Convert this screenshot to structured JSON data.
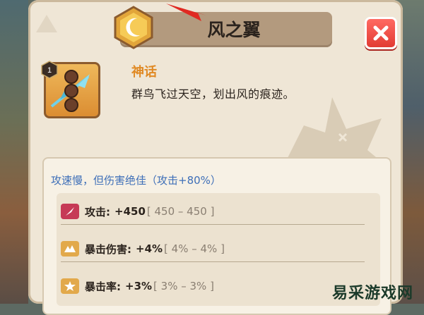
{
  "dialog": {
    "title": "风之翼",
    "close_icon": "close-x-icon"
  },
  "item": {
    "level_badge": "1",
    "rarity": "神话",
    "description": "群鸟飞过天空，划出风的痕迹。"
  },
  "stats": {
    "intro": "攻速慢，但伤害绝佳（攻击+80%）",
    "rows": [
      {
        "icon": "attack-icon",
        "name": "攻击:",
        "value": "+450",
        "range": "[ 450 – 450 ]",
        "icon_color": "#c63a56"
      },
      {
        "icon": "crit-damage-icon",
        "name": "暴击伤害:",
        "value": "+4%",
        "range": "[ 4% – 4% ]",
        "icon_color": "#e2a94b"
      },
      {
        "icon": "crit-rate-icon",
        "name": "暴击率:",
        "value": "+3%",
        "range": "[ 3% – 3% ]",
        "icon_color": "#e2a94b"
      }
    ]
  },
  "watermark": "易采游戏网"
}
